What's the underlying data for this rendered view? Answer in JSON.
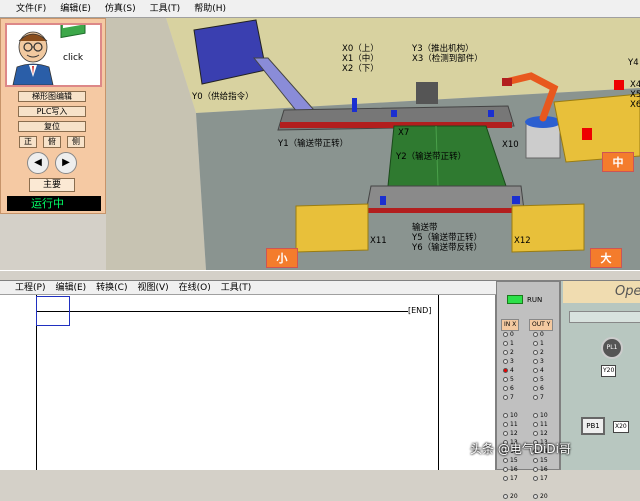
{
  "menu": [
    "文件(F)",
    "编辑(E)",
    "仿真(S)",
    "工具(T)",
    "帮助(H)"
  ],
  "control": {
    "click_label": "click",
    "buttons": [
      "梯形图编辑",
      "PLC写入",
      "复位"
    ],
    "view_buttons": [
      "正",
      "俯",
      "侧"
    ],
    "main_label": "主要",
    "status": "运行中"
  },
  "scene": {
    "labels": {
      "y0": "Y0（供给指令）",
      "x0": "X0（上）",
      "x1": "X1（中）",
      "x2": "X2（下）",
      "y3": "Y3（推出机构）",
      "x3": "X3（检测到部件）",
      "y1": "Y1（输送带正转）",
      "x7": "X7",
      "y2": "Y2（输送带正转）",
      "x10": "X10",
      "x11": "X11",
      "belt": "输送带",
      "y5": "Y5（输送带正转）",
      "y6": "Y6（输送带反转）",
      "x12": "X12",
      "y4": "Y4",
      "x4": "X4",
      "x5": "X5",
      "x6": "X6"
    },
    "bins": {
      "small": "小",
      "middle": "中",
      "large": "大"
    }
  },
  "editor_menu": [
    "工程(P)",
    "编辑(E)",
    "转换(C)",
    "视图(V)",
    "在线(O)",
    "工具(T)"
  ],
  "ladder": {
    "end_label": "END"
  },
  "io": {
    "run_label": "RUN",
    "in_header": "IN X",
    "out_header": "OUT Y",
    "in_rows": [
      "0",
      "1",
      "2",
      "3",
      "4",
      "5",
      "6",
      "7",
      "",
      "10",
      "11",
      "12",
      "13",
      "14",
      "15",
      "16",
      "17",
      "",
      "20"
    ],
    "out_rows": [
      "0",
      "1",
      "2",
      "3",
      "4",
      "5",
      "6",
      "7",
      "",
      "10",
      "11",
      "12",
      "13",
      "14",
      "15",
      "16",
      "17",
      "",
      "20"
    ],
    "in_active": [
      "4"
    ]
  },
  "operation": {
    "title": "Ope",
    "lamp_label": "PL1",
    "y_label": "Y20",
    "pb_label": "PB1",
    "x_label": "X20"
  },
  "watermark": "头条 @电气DiDi哥"
}
